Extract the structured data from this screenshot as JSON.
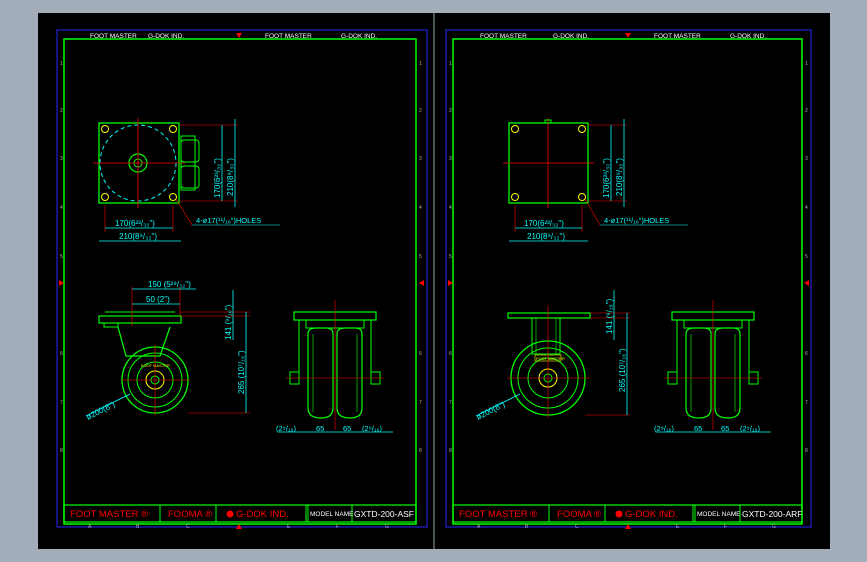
{
  "colors": {
    "workspace": "#a3adb9",
    "paper": "#000000",
    "frame": "#00ff00",
    "outer_frame": "#1a1aa8",
    "dimension": "#00ffff",
    "leader": "#ff0000",
    "center_line": "#ff0000",
    "hidden_line": "#00ffff",
    "title_text": "#ff0000",
    "header_text": "#ffffff",
    "zone_text": "#b0b0b0",
    "arrow": "#ff0000",
    "yellow": "#ffff00"
  },
  "zone_labels": {
    "columns": [
      "A",
      "B",
      "C",
      "D",
      "E",
      "F",
      "G"
    ],
    "rows": [
      "1",
      "2",
      "3",
      "4",
      "5",
      "6",
      "7",
      "8"
    ]
  },
  "sheets": [
    {
      "id": "left",
      "header": [
        "FOOT MASTER",
        "G-DOK IND.",
        "FOOT MASTER",
        "G-DOK IND."
      ],
      "title_block": {
        "brand1": "FOOT MASTER ®",
        "brand2": "FOOMA ®",
        "brand3": "G-DOK IND.",
        "model_label": "MODEL NAME",
        "model_value": "GXTD-200-ASF"
      },
      "top_view": {
        "dim_v_inner": "170(6²³/₃₂\")",
        "dim_v_outer": "210(8⁹/₃₂\")",
        "dim_h_inner": "170(6²³/₃₂\")",
        "dim_h_outer": "210(8⁹/₃₂\")",
        "holes_note": "4-ø17(¹¹/₁₆\")HOLES"
      },
      "side_view": {
        "dim_offset_outer": "150 (5²⁹/₃₂\")",
        "dim_offset_inner": "50 (2\")",
        "dim_plate": "141 (⁹/₁₆\")",
        "dim_height": "265 (10⁷/₁₆\")",
        "dim_wheel": "ø200(8\")",
        "wheel_label": "FOOT MASTER"
      },
      "front_view": {
        "dim_a": "(2⁹/₁₆)",
        "dim_b": "65",
        "dim_c": "65",
        "dim_d": "(2⁹/₁₆)"
      }
    },
    {
      "id": "right",
      "header": [
        "FOOT MASTER",
        "G-DOK IND.",
        "FOOT MASTER",
        "G-DOK IND."
      ],
      "title_block": {
        "brand1": "FOOT MASTER ®",
        "brand2": "FOOMA ®",
        "brand3": "G-DOK IND.",
        "model_label": "MODEL NAME",
        "model_value": "GXTD-200-ARF"
      },
      "top_view": {
        "dim_v_inner": "170(6²³/₃₂\")",
        "dim_v_outer": "210(8⁹/₃₂\")",
        "dim_h_inner": "170(6²³/₃₂\")",
        "dim_h_outer": "210(8⁹/₃₂\")",
        "holes_note": "4-ø17(¹¹/₁₆\")HOLES"
      },
      "side_view": {
        "dim_plate": "141 (⁹/₁₆\")",
        "dim_height": "265 (10⁷/₁₆\")",
        "dim_wheel": "ø200(8\")",
        "wheel_label": "FOOT MASTER"
      },
      "front_view": {
        "dim_a": "(2⁹/₁₆)",
        "dim_b": "65",
        "dim_c": "65",
        "dim_d": "(2⁹/₁₆)"
      }
    }
  ]
}
